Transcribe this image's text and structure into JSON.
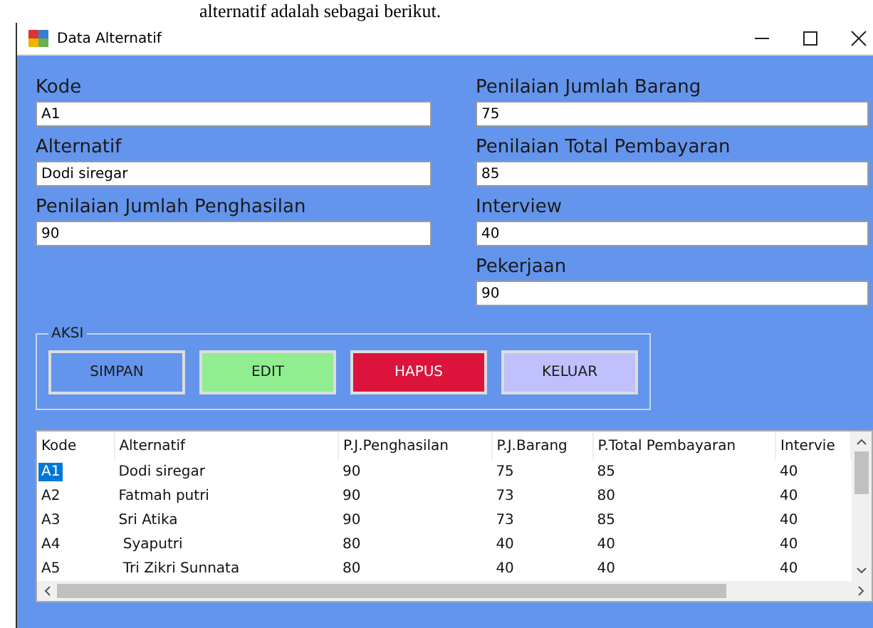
{
  "document_text": "alternatif adalah sebagai berikut.",
  "window": {
    "title": "Data Alternatif"
  },
  "left_fields": [
    {
      "label": "Kode",
      "value": "A1"
    },
    {
      "label": "Alternatif",
      "value": "Dodi siregar"
    },
    {
      "label": "Penilaian Jumlah Penghasilan",
      "value": "90"
    }
  ],
  "right_fields": [
    {
      "label": "Penilaian Jumlah Barang",
      "value": "75"
    },
    {
      "label": "Penilaian Total Pembayaran",
      "value": "85"
    },
    {
      "label": "Interview",
      "value": "40"
    },
    {
      "label": "Pekerjaan",
      "value": "90"
    }
  ],
  "actions": {
    "title": "AKSI",
    "buttons": [
      {
        "label": "SIMPAN",
        "color": "#6495ed"
      },
      {
        "label": "EDIT",
        "color": "#90ee90"
      },
      {
        "label": "HAPUS",
        "color": "#dc143c"
      },
      {
        "label": "KELUAR",
        "color": "#c0c0ff"
      }
    ]
  },
  "table": {
    "columns": [
      "Kode",
      "Alternatif",
      "P.J.Penghasilan",
      "P.J.Barang",
      "P.Total Pembayaran",
      "Intervie"
    ],
    "rows": [
      {
        "cells": [
          "A1",
          "Dodi siregar",
          "90",
          "75",
          "85",
          "40"
        ],
        "selected": true
      },
      {
        "cells": [
          "A2",
          "Fatmah putri",
          "90",
          "73",
          "80",
          "40"
        ],
        "selected": false
      },
      {
        "cells": [
          "A3",
          "Sri Atika",
          "90",
          "73",
          "85",
          "40"
        ],
        "selected": false
      },
      {
        "cells": [
          "A4",
          " Syaputri",
          "80",
          "40",
          "40",
          "40"
        ],
        "selected": false
      },
      {
        "cells": [
          "A5",
          " Tri Zikri Sunnata",
          "80",
          "40",
          "40",
          "40"
        ],
        "selected": false
      }
    ]
  }
}
